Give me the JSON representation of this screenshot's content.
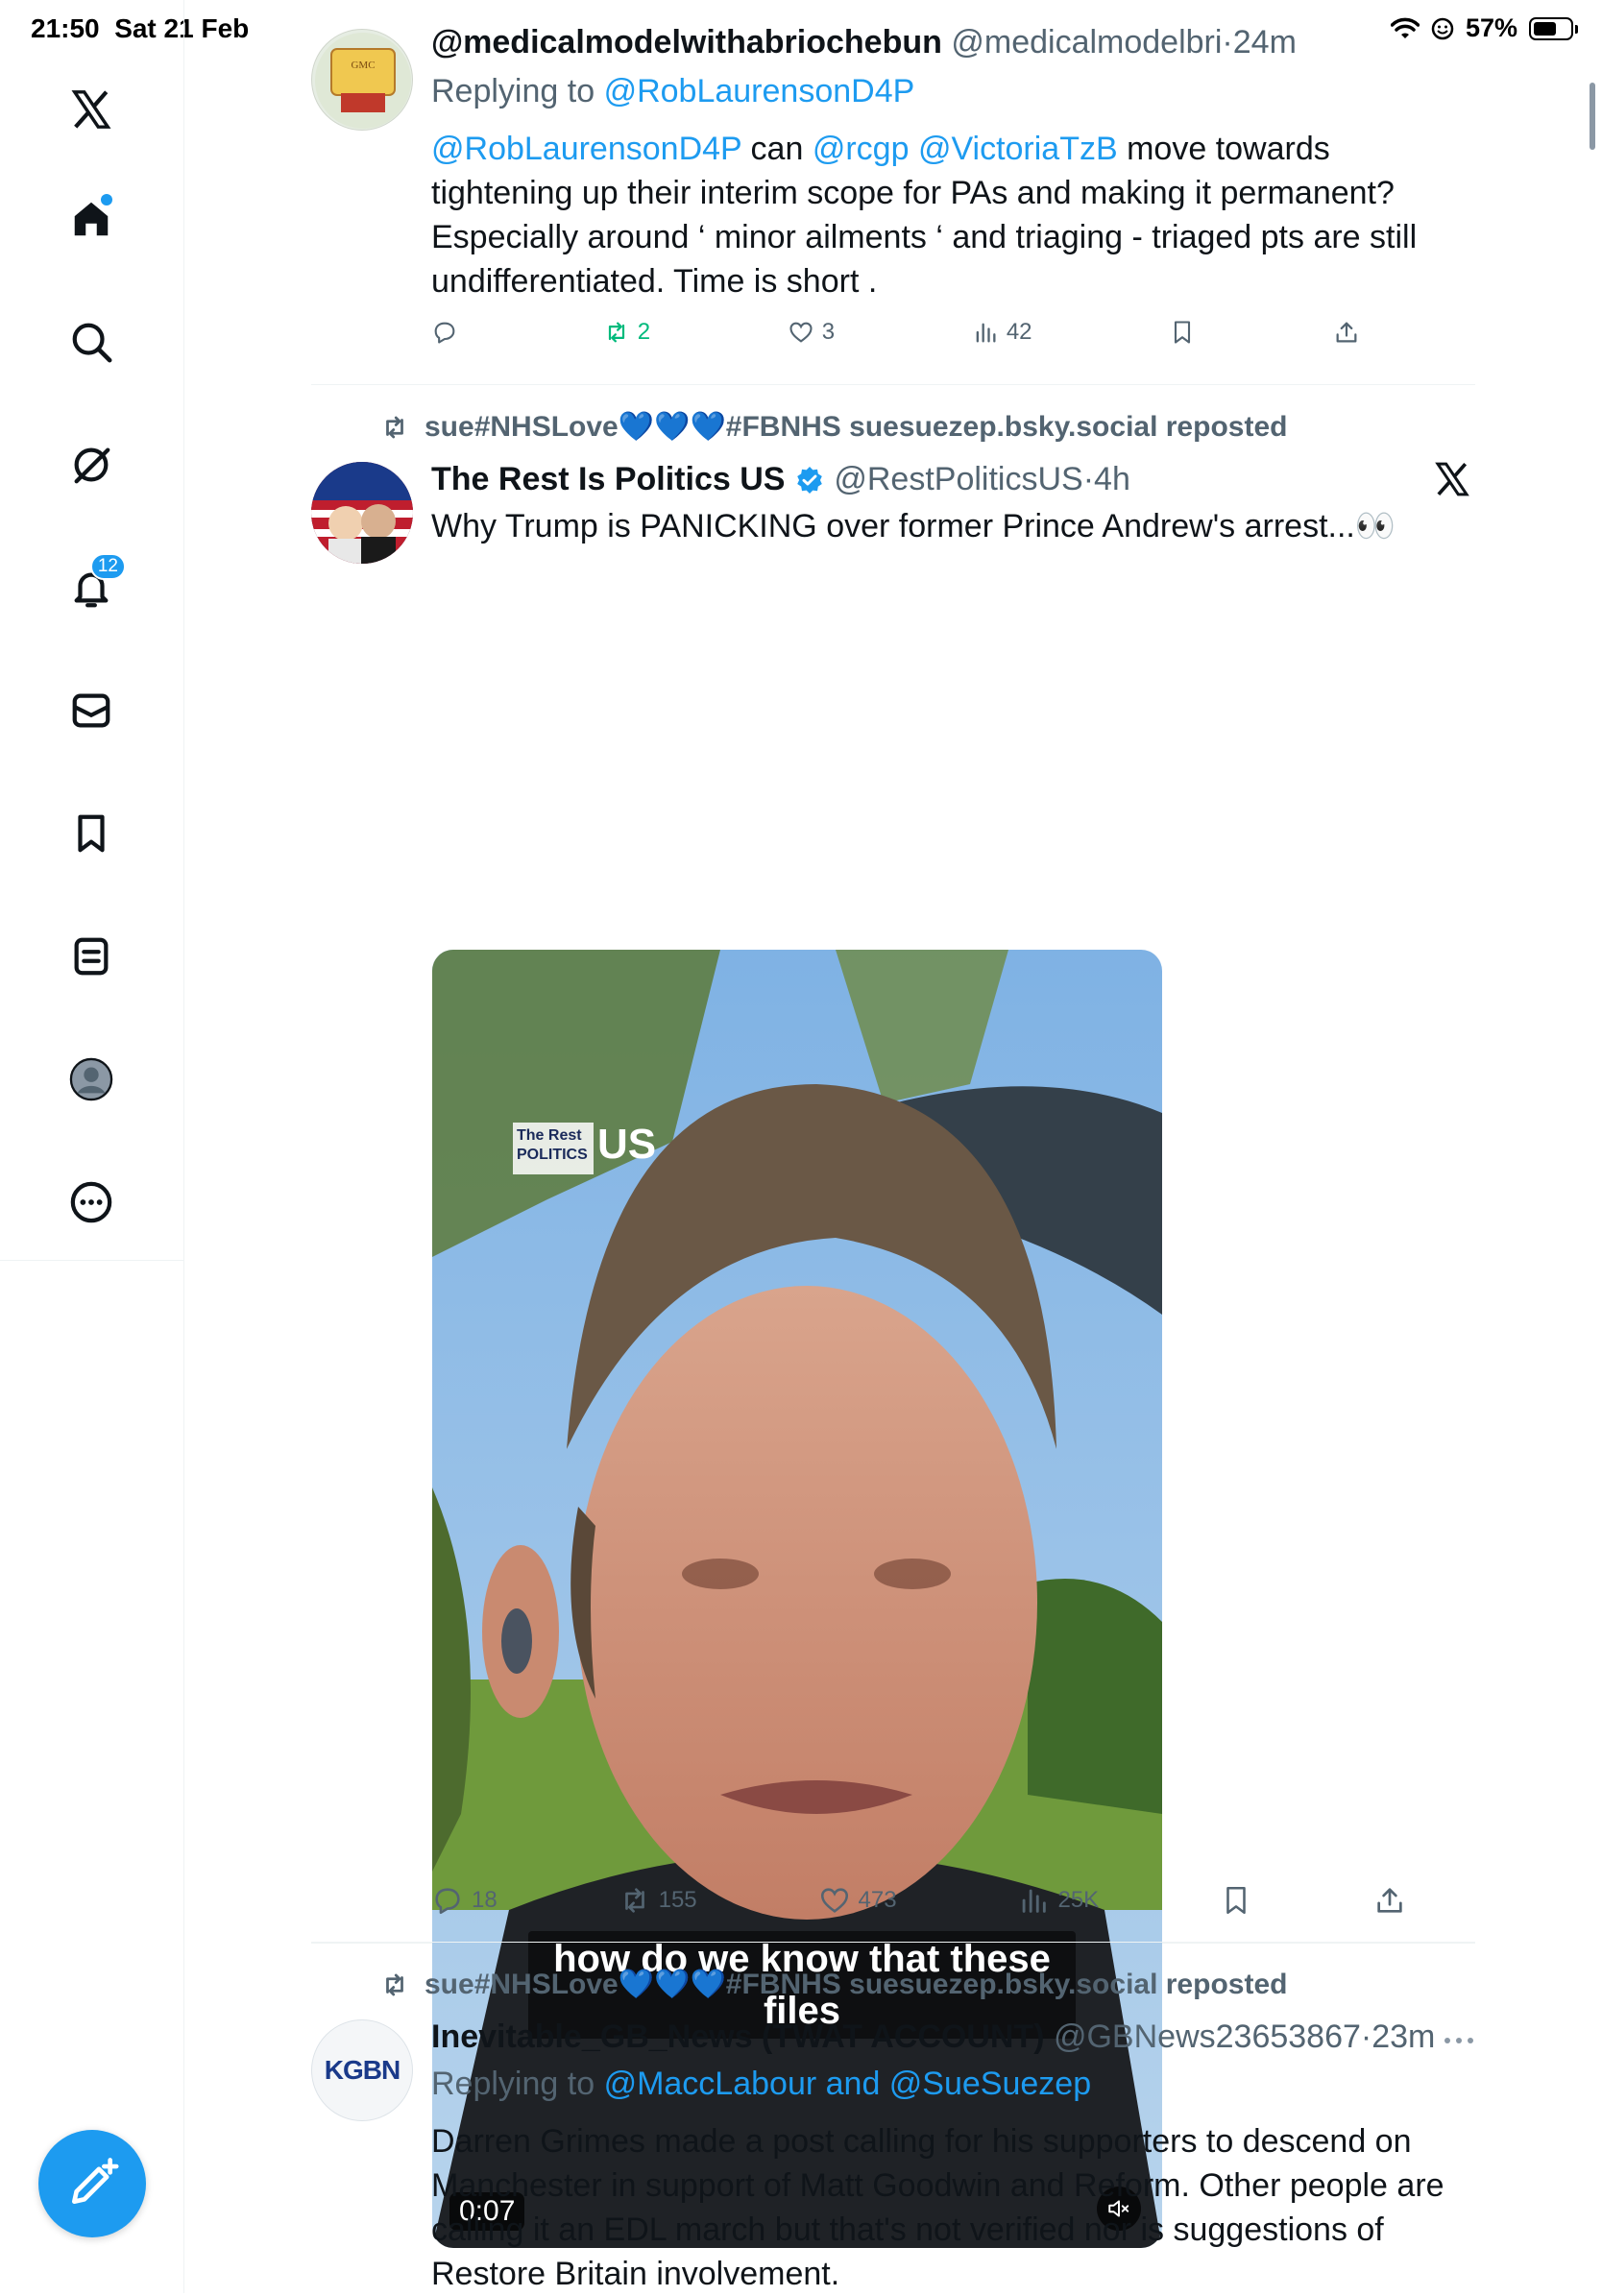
{
  "status_bar": {
    "time": "21:50",
    "date": "Sat 21 Feb",
    "battery": "57%",
    "battery_level": 0.57
  },
  "sidebar": {
    "items": [
      {
        "name": "x-logo-icon"
      },
      {
        "name": "home-icon",
        "has_dot": true
      },
      {
        "name": "search-icon"
      },
      {
        "name": "grok-icon"
      },
      {
        "name": "bell-icon",
        "badge": "12"
      },
      {
        "name": "messages-icon"
      },
      {
        "name": "bookmark-icon"
      },
      {
        "name": "lists-icon"
      },
      {
        "name": "profile-icon"
      },
      {
        "name": "more-icon"
      }
    ],
    "compose": {
      "icon": "compose-icon"
    }
  },
  "posts": [
    {
      "display_name": "@medicalmodelwithabriochebun",
      "handle": "@medicalmodelbri",
      "time": "24m",
      "reply_prefix": "Replying to",
      "reply_to": "@RobLaurensonD4P",
      "text_parts": [
        {
          "t": "@RobLaurensonD4P",
          "link": true
        },
        {
          "t": " can ",
          "link": false
        },
        {
          "t": "@rcgp",
          "link": true
        },
        {
          "t": " ",
          "link": false
        },
        {
          "t": "@VictoriaTzB",
          "link": true
        },
        {
          "t": "  move towards tightening up their interim scope for PAs and making it permanent? Especially around ‘ minor ailments ‘ and triaging - triaged pts are still undifferentiated. Time is short .",
          "link": false
        }
      ],
      "stats": {
        "replies": "",
        "reposts": "2",
        "likes": "3",
        "views": "42"
      },
      "avatar_text": "General Medical Council"
    },
    {
      "repost_by": "sue#NHSLove💙💙💙#FBNHS suesuezep.bsky.social reposted",
      "display_name": "The Rest Is Politics US",
      "handle": "@RestPoliticsUS",
      "time": "4h",
      "text": "Why Trump is PANICKING over former Prince Andrew's arrest...👀",
      "video": {
        "caption": "how do we know that these files",
        "timecode": "0:07",
        "watermark_1": "The Rest",
        "watermark_2": "POLITICS",
        "watermark_3": "US"
      },
      "stats": {
        "replies": "18",
        "reposts": "155",
        "likes": "473",
        "views": "25K"
      }
    },
    {
      "repost_by": "sue#NHSLove💙💙💙#FBNHS suesuezep.bsky.social reposted",
      "display_name": "Inevitable_GB_News (TWAT ACCOUNT)",
      "handle": "@GBNews23653867",
      "time": "23m",
      "reply_prefix": "Replying to",
      "reply_to": "@MaccLabour and @SueSuezep",
      "text": "Darren Grimes made a post calling for his supporters to descend on Manchester in support of Matt Goodwin and Reform. Other people are calling it an EDL march but that's not verified nor is suggestions of Restore Britain involvement.",
      "avatar_text": "KGBN"
    }
  ]
}
